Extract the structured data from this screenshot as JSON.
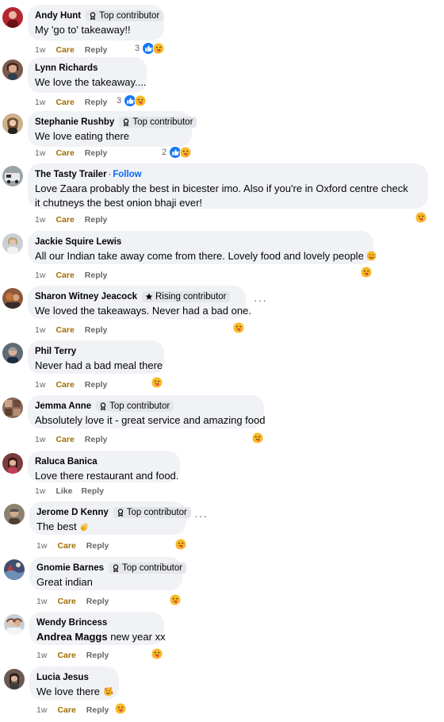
{
  "comments": [
    {
      "author": "Andy Hunt",
      "badge": "Top contributor",
      "text": "My 'go to' takeaway!!",
      "time": "1w",
      "reaction": "Care",
      "reply": "Reply",
      "count": "3"
    },
    {
      "author": "Lynn Richards",
      "text": "We love the takeaway....",
      "time": "1w",
      "reaction": "Care",
      "reply": "Reply",
      "count": "3"
    },
    {
      "author": "Stephanie Rushby",
      "badge": "Top contributor",
      "text": "We love eating there",
      "time": "1w",
      "reaction": "Care",
      "reply": "Reply",
      "count": "2"
    },
    {
      "author": "The Tasty Trailer",
      "follow": "Follow",
      "text": "Love Zaara probably the best in bicester imo. Also if you're in Oxford centre check it chutneys the best onion bhaji ever!",
      "time": "1w",
      "reaction": "Care",
      "reply": "Reply"
    },
    {
      "author": "Jackie Squire Lewis",
      "text": "All our Indian take away come from there. Lovely food and lovely people",
      "time": "1w",
      "reaction": "Care",
      "reply": "Reply"
    },
    {
      "author": "Sharon Witney Jeacock",
      "badge": "Rising contributor",
      "text": "We loved the takeaways. Never had a bad one.",
      "time": "1w",
      "reaction": "Care",
      "reply": "Reply",
      "more": "···"
    },
    {
      "author": "Phil Terry",
      "text": "Never had a bad meal there",
      "time": "1w",
      "reaction": "Care",
      "reply": "Reply"
    },
    {
      "author": "Jemma Anne",
      "badge": "Top contributor",
      "text": "Absolutely love it - great service and amazing food",
      "time": "1w",
      "reaction": "Care",
      "reply": "Reply"
    },
    {
      "author": "Raluca Banica",
      "text": "Love there restaurant and food.",
      "time": "1w",
      "reaction": "Like",
      "reply": "Reply"
    },
    {
      "author": "Jerome D Kenny",
      "badge": "Top contributor",
      "text": "The best",
      "time": "1w",
      "reaction": "Care",
      "reply": "Reply",
      "more": "···"
    },
    {
      "author": "Gnomie Barnes",
      "badge": "Top contributor",
      "text": "Great indian",
      "time": "1w",
      "reaction": "Care",
      "reply": "Reply"
    },
    {
      "author": "Wendy Brincess",
      "mention": "Andrea Maggs",
      "text": "new year xx",
      "time": "1w",
      "reaction": "Care",
      "reply": "Reply"
    },
    {
      "author": "Lucia Jesus",
      "text": "We love there",
      "time": "1w",
      "reaction": "Care",
      "reply": "Reply"
    }
  ],
  "colors": {
    "bubble": "#f0f2f5",
    "badge_bg": "#e4e6eb",
    "care_text": "#a26d00",
    "follow_link": "#0866ff",
    "meta_text": "#65676b",
    "like_blue": "#1877f2",
    "care_yellow": "#f7b928"
  },
  "icons": {
    "top_contributor": "award-ribbon-icon",
    "rising_contributor": "star-icon",
    "like_reaction": "thumbs-up-icon",
    "care_reaction": "care-hug-emoji-icon",
    "smile_emoji": "smiling-face-emoji-icon",
    "ok_hand_emoji": "ok-hand-emoji-icon",
    "hearts_emoji": "smiling-face-with-hearts-emoji-icon"
  }
}
